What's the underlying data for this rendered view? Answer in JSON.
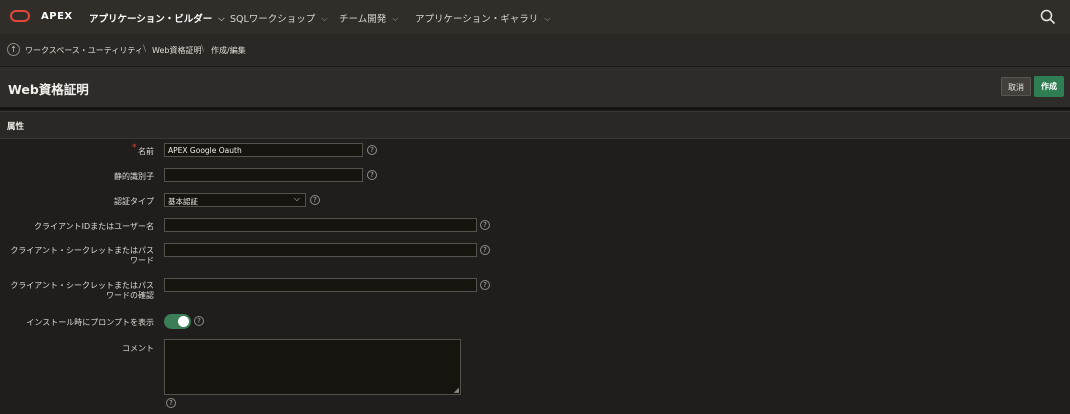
{
  "header": {
    "brand": "APEX",
    "nav": [
      {
        "label": "アプリケーション・ビルダー",
        "active": true
      },
      {
        "label": "SQLワークショップ",
        "active": false
      },
      {
        "label": "チーム開発",
        "active": false
      },
      {
        "label": "アプリケーション・ギャラリ",
        "active": false
      }
    ],
    "search_icon": "search-icon",
    "brand_color": "#e0463a"
  },
  "breadcrumb": {
    "up_icon": "arrow-up-icon",
    "items": [
      "ワークスペース・ユーティリティ",
      "Web資格証明",
      "作成/編集"
    ]
  },
  "page": {
    "title": "Web資格証明",
    "cancel_label": "取消",
    "create_label": "作成",
    "create_color": "#2f7d52"
  },
  "section": {
    "title": "属性"
  },
  "form": {
    "name_label": "名前",
    "name_value": "APEX Google Oauth",
    "static_id_label": "静的識別子",
    "static_id_value": "",
    "auth_type_label": "認証タイプ",
    "auth_type_value": "基本認証",
    "client_id_label": "クライアントIDまたはユーザー名",
    "client_id_value": "",
    "client_secret_label": "クライアント・シークレットまたはパスワード",
    "client_secret_value": "",
    "client_secret_confirm_label": "クライアント・シークレットまたはパスワードの確認",
    "client_secret_confirm_value": "",
    "prompt_label": "インストール時にプロンプトを表示",
    "prompt_on": true,
    "comment_label": "コメント",
    "comment_value": "",
    "help_glyph": "?",
    "required_mark": "*"
  }
}
